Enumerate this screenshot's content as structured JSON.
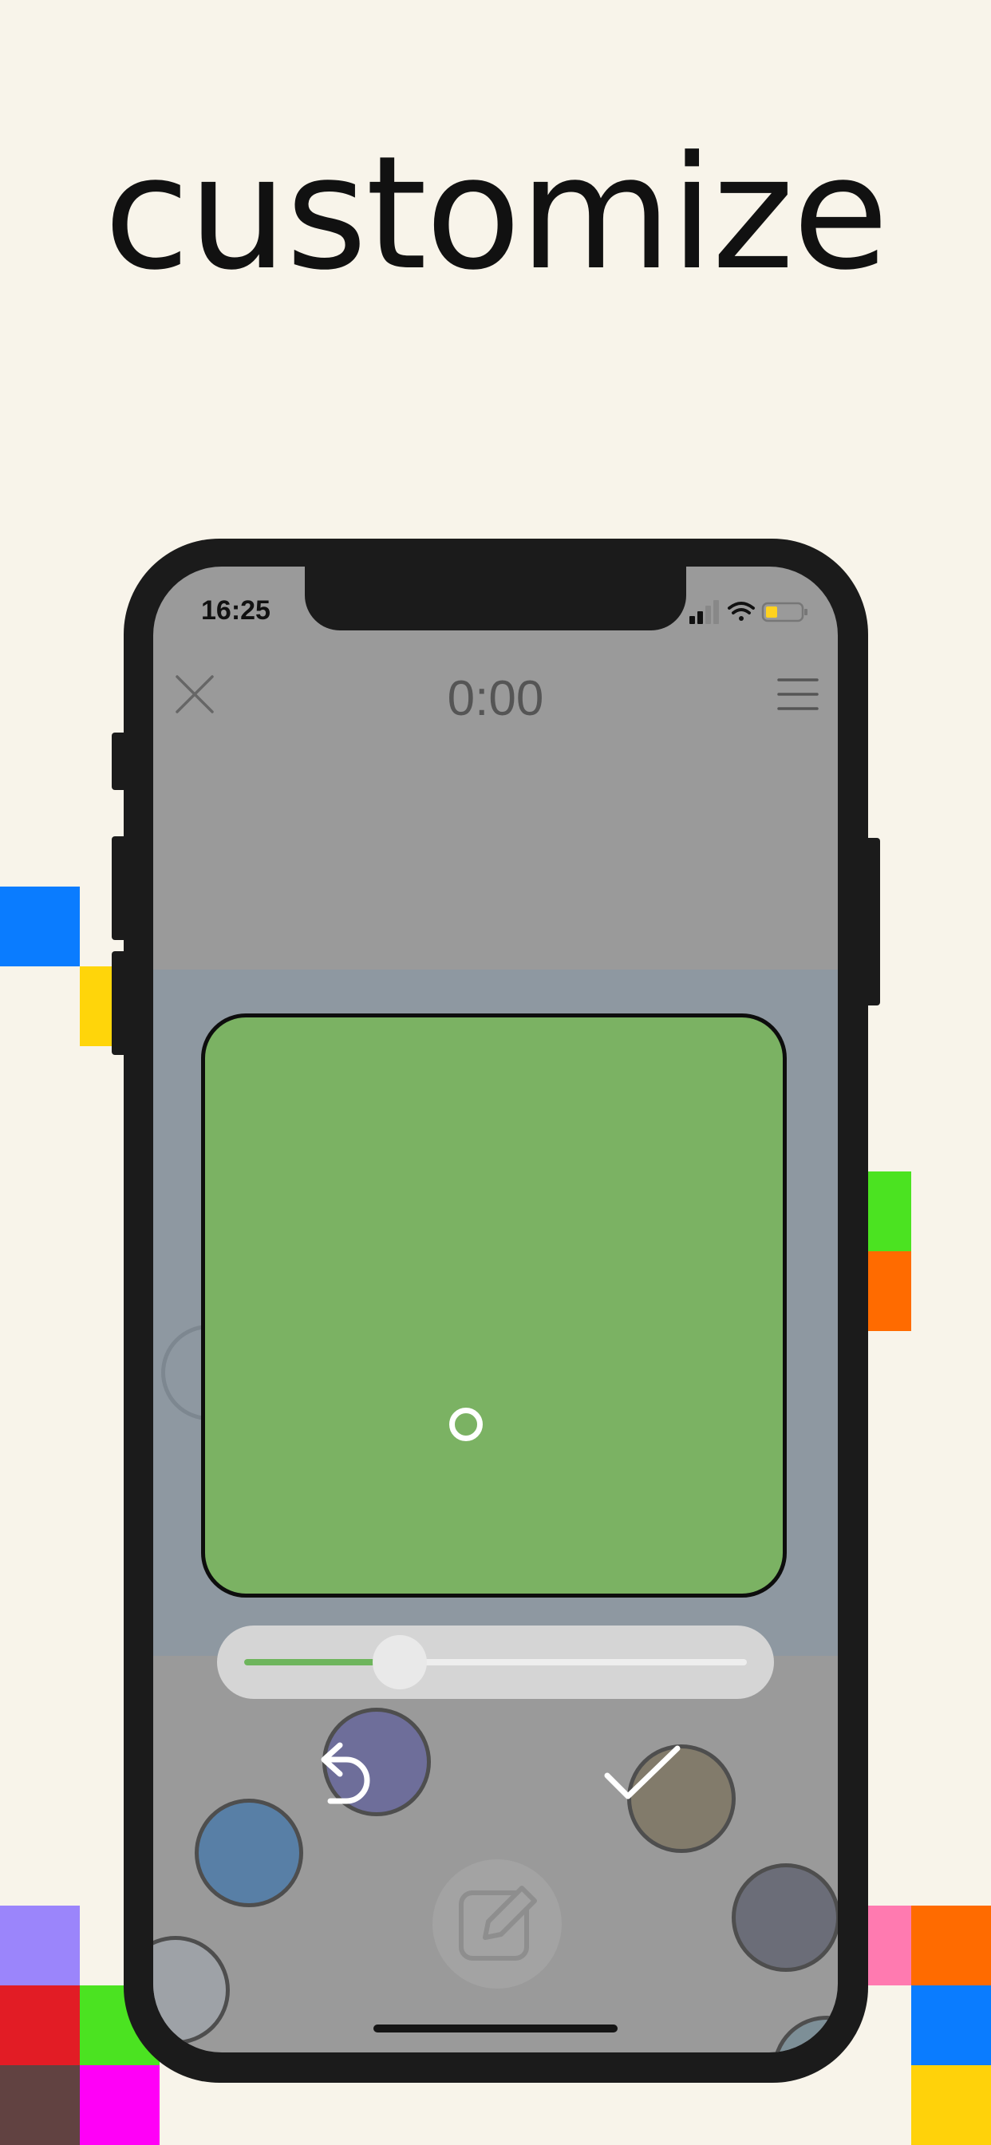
{
  "headline": "customize",
  "phone": {
    "status_bar": {
      "time": "16:25"
    },
    "timer": "0:00",
    "icons": {
      "close": "close-icon",
      "menu": "menu-icon",
      "undo": "undo-icon",
      "confirm": "checkmark-icon",
      "edit": "edit-icon"
    },
    "selected_color": "#7bb263",
    "size_slider": {
      "value": 0.31
    }
  },
  "colors": {
    "background": "#f8f4ea",
    "screen_overlay": "#9a9a9a",
    "canvas_band": "#8e98a1",
    "accent_green": "#6eb55c",
    "palette_dots": [
      "#6e6e9a",
      "#587fa6",
      "#827b6b",
      "#6b6d78",
      "#9ea2a7",
      "#7d8f97"
    ],
    "decor_squares": [
      "#0a7cff",
      "#ffd50a",
      "#4be321",
      "#ff6b00",
      "#9b85fb",
      "#e21c25",
      "#614241",
      "#ff00f7",
      "#ff7ab0",
      "#ffd20a"
    ]
  }
}
